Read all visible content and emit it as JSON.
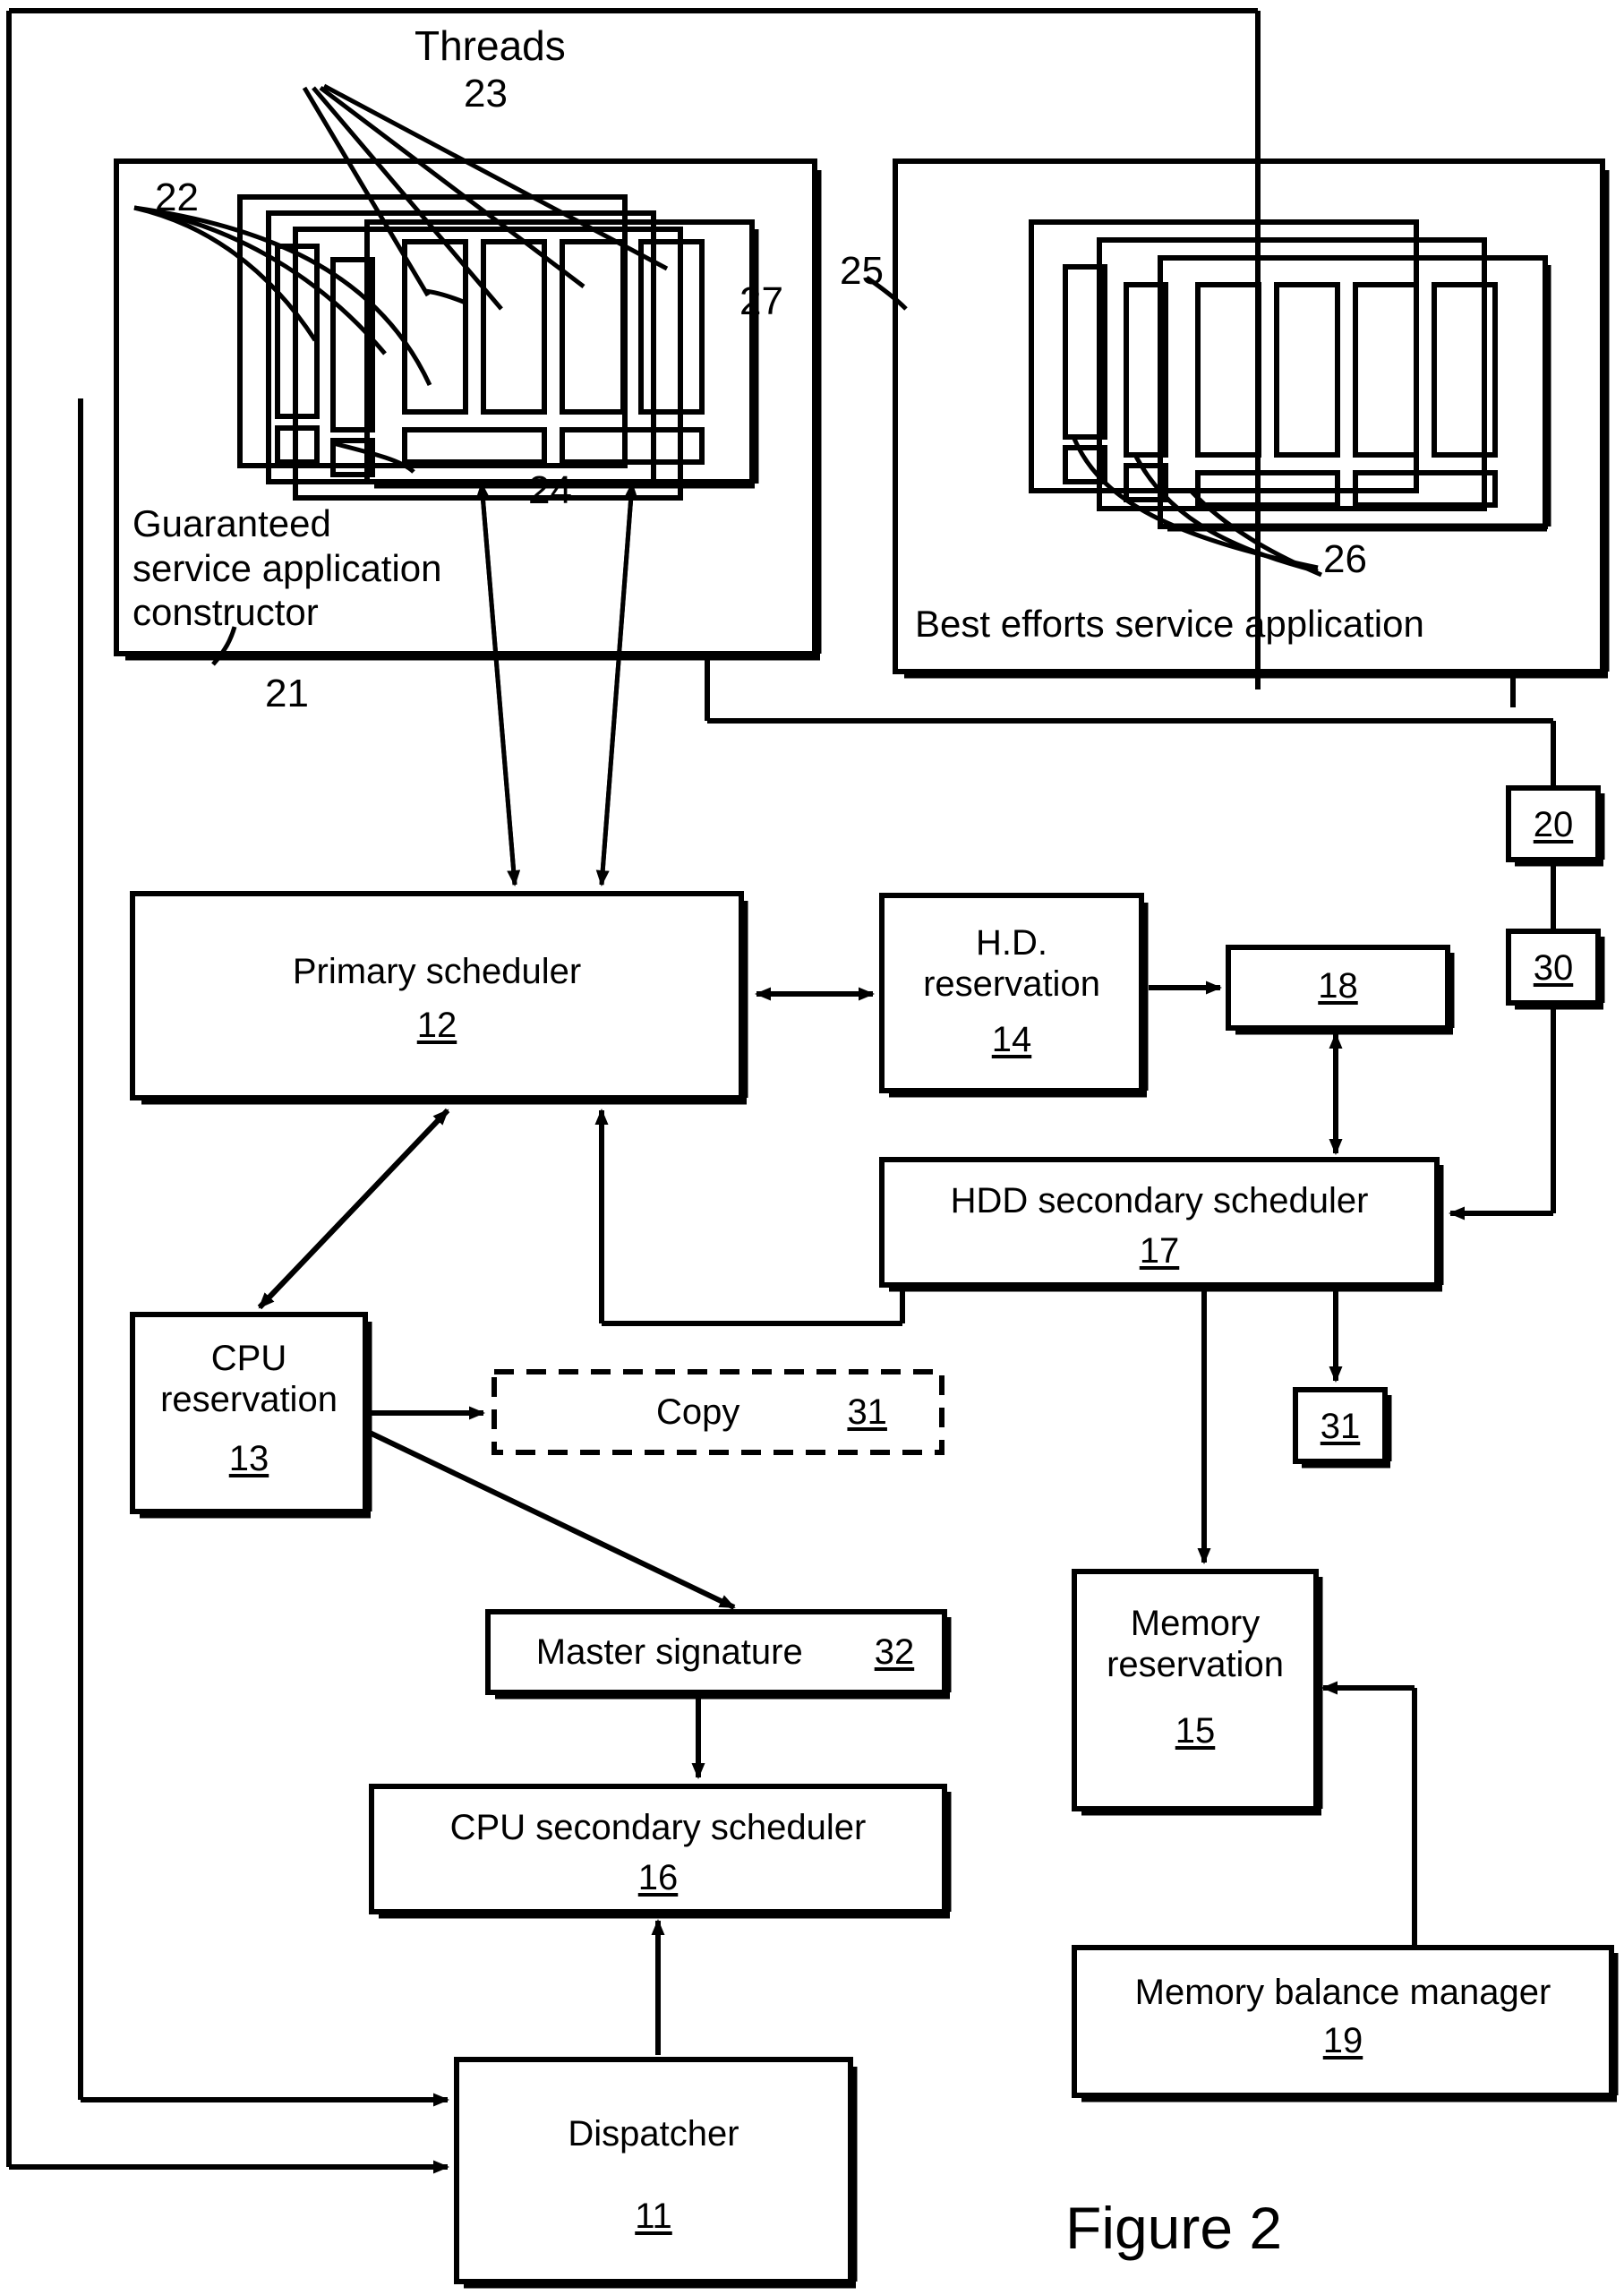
{
  "figure": {
    "caption": "Figure 2"
  },
  "annotations": {
    "threads_label": "Threads",
    "threads_ref": "23",
    "windows_ref_left": "22",
    "taskbar_ref": "24",
    "window_ref": "27",
    "guaranteed_panel_ref": "21",
    "best_efforts_panel_ref": "25",
    "best_efforts_windows_ref": "26"
  },
  "panels": [
    {
      "name": "guaranteed-service-application-constructor",
      "caption_line1": "Guaranteed",
      "caption_line2": "service application",
      "caption_line3": "constructor",
      "ref": "21"
    },
    {
      "name": "best-efforts-service-application",
      "caption": "Best efforts service application",
      "ref": "25"
    }
  ],
  "blocks": [
    {
      "id": "primary-scheduler",
      "label": "Primary scheduler",
      "ref": "12"
    },
    {
      "id": "hd-reservation",
      "label_line1": "H.D.",
      "label_line2": "reservation",
      "ref": "14"
    },
    {
      "id": "node-18",
      "label": "",
      "ref": "18"
    },
    {
      "id": "node-20",
      "label": "",
      "ref": "20"
    },
    {
      "id": "node-30",
      "label": "",
      "ref": "30"
    },
    {
      "id": "hdd-secondary-scheduler",
      "label": "HDD secondary scheduler",
      "ref": "17"
    },
    {
      "id": "node-31-right",
      "label": "",
      "ref": "31"
    },
    {
      "id": "cpu-reservation",
      "label_line1": "CPU",
      "label_line2": "reservation",
      "ref": "13"
    },
    {
      "id": "copy",
      "label": "Copy",
      "ref": "31"
    },
    {
      "id": "master-signature",
      "label": "Master signature",
      "ref": "32"
    },
    {
      "id": "cpu-secondary-scheduler",
      "label": "CPU secondary scheduler",
      "ref": "16"
    },
    {
      "id": "memory-reservation",
      "label_line1": "Memory",
      "label_line2": "reservation",
      "ref": "15"
    },
    {
      "id": "memory-balance-manager",
      "label": "Memory balance manager",
      "ref": "19"
    },
    {
      "id": "dispatcher",
      "label": "Dispatcher",
      "ref": "11"
    }
  ],
  "colors": {
    "ink": "#000000",
    "paper": "#ffffff"
  }
}
